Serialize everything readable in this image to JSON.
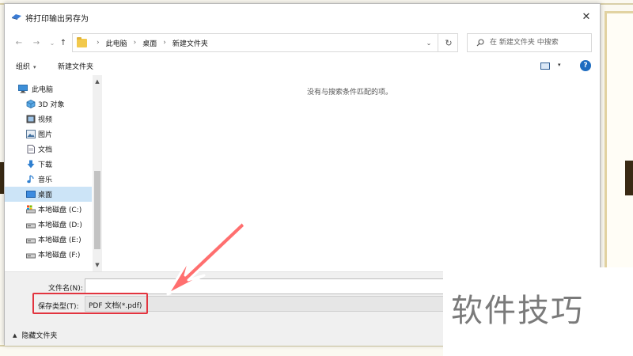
{
  "dialog": {
    "title": "将打印输出另存为",
    "close_glyph": "✕"
  },
  "nav": {
    "back_glyph": "←",
    "forward_glyph": "→",
    "recent_glyph": "⌄",
    "up_glyph": "↑",
    "crumbs": [
      "此电脑",
      "桌面",
      "新建文件夹"
    ],
    "crumb_sep": "›",
    "dropdown_glyph": "⌄",
    "refresh_glyph": "↻"
  },
  "search": {
    "placeholder": "在 新建文件夹 中搜索"
  },
  "toolbar": {
    "organize_label": "组织",
    "organize_caret": "▾",
    "new_folder_label": "新建文件夹",
    "view_caret": "▾",
    "help_glyph": "?"
  },
  "sidebar": {
    "items": [
      {
        "label": "此电脑",
        "icon": "computer-icon"
      },
      {
        "label": "3D 对象",
        "icon": "3d-objects-icon"
      },
      {
        "label": "视频",
        "icon": "video-icon"
      },
      {
        "label": "图片",
        "icon": "pictures-icon"
      },
      {
        "label": "文档",
        "icon": "documents-icon"
      },
      {
        "label": "下载",
        "icon": "download-icon"
      },
      {
        "label": "音乐",
        "icon": "music-icon"
      },
      {
        "label": "桌面",
        "icon": "desktop-icon",
        "selected": true
      },
      {
        "label": "本地磁盘 (C:)",
        "icon": "drive-c-icon"
      },
      {
        "label": "本地磁盘 (D:)",
        "icon": "drive-icon"
      },
      {
        "label": "本地磁盘 (E:)",
        "icon": "drive-icon"
      },
      {
        "label": "本地磁盘 (F:)",
        "icon": "drive-icon"
      }
    ],
    "scroll_up_glyph": "▲",
    "scroll_down_glyph": "▼"
  },
  "main": {
    "empty_message": "没有与搜索条件匹配的项。"
  },
  "bottom": {
    "filename_label": "文件名(N):",
    "filename_value": "",
    "filetype_label": "保存类型(T):",
    "filetype_value": "PDF 文档(*.pdf)",
    "hide_folders_caret": "▲",
    "hide_folders_label": "隐藏文件夹"
  },
  "overlay": {
    "watermark_text": "软件技巧",
    "highlight_color": "#e2343f"
  }
}
